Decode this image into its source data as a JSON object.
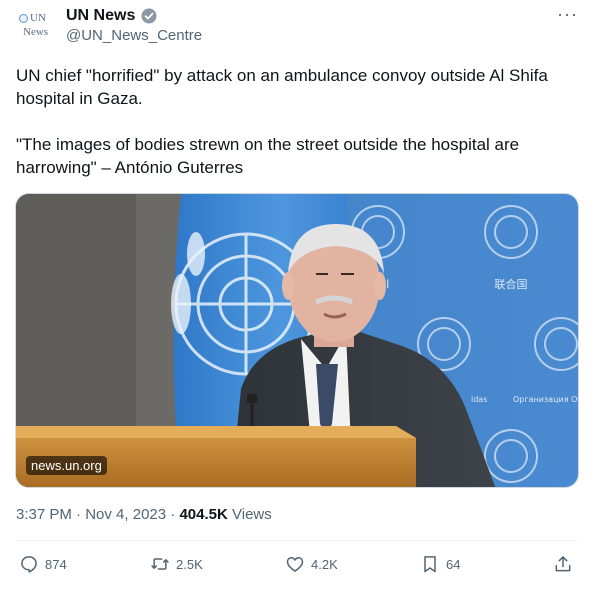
{
  "account": {
    "avatar_text_line1": "UN",
    "avatar_text_line2": "News",
    "display_name": "UN News",
    "handle": "@UN_News_Centre",
    "verified_badge_color": "#8b98a5"
  },
  "more_menu_icon": "more-horizontal-icon",
  "tweet": {
    "paragraph1": "UN chief \"horrified\" by attack on an ambulance convoy outside Al Shifa hospital in Gaza.",
    "paragraph2": "\"The images of bodies strewn on the street outside the hospital are harrowing\" – António Guterres"
  },
  "media": {
    "source_label": "news.un.org",
    "backdrop_text_arabic": "الأمم",
    "backdrop_text_chinese": "联合国",
    "backdrop_text_russian": "Организация Объ",
    "backdrop_text_fragment": "ldas"
  },
  "meta": {
    "time": "3:37 PM",
    "separator1": "·",
    "date": "Nov 4, 2023",
    "separator2": "·",
    "views_count": "404.5K",
    "views_label": "Views"
  },
  "actions": {
    "reply_count": "874",
    "retweet_count": "2.5K",
    "like_count": "4.2K",
    "bookmark_count": "64"
  }
}
